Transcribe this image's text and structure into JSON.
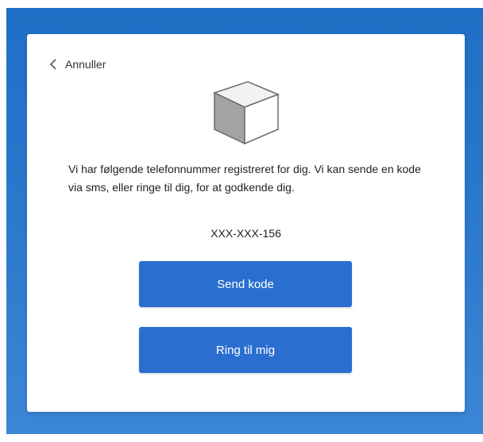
{
  "dialog": {
    "cancel_label": "Annuller",
    "icons": {
      "back": "chevron-left-icon",
      "illustration": "cube-icon"
    },
    "message": "Vi har følgende telefonnummer registreret for dig. Vi kan sende en kode via sms, eller ringe til dig, for at godkende dig.",
    "phone_number": "XXX-XXX-156",
    "send_code_label": "Send kode",
    "call_me_label": "Ring til mig"
  },
  "colors": {
    "background": "#2a78cc",
    "button": "#2a6fd0",
    "card": "#ffffff"
  }
}
